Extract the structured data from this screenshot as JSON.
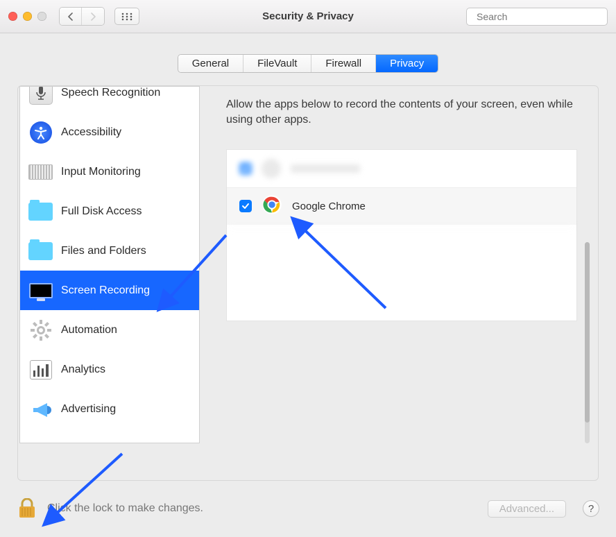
{
  "window_title": "Security & Privacy",
  "search": {
    "placeholder": "Search"
  },
  "tabs": {
    "items": [
      "General",
      "FileVault",
      "Firewall",
      "Privacy"
    ],
    "active_index": 3
  },
  "sidebar": {
    "items": [
      {
        "label": "Speech Recognition",
        "icon": "microphone-icon"
      },
      {
        "label": "Accessibility",
        "icon": "accessibility-icon"
      },
      {
        "label": "Input Monitoring",
        "icon": "keyboard-icon"
      },
      {
        "label": "Full Disk Access",
        "icon": "folder-icon"
      },
      {
        "label": "Files and Folders",
        "icon": "folder-icon"
      },
      {
        "label": "Screen Recording",
        "icon": "monitor-icon"
      },
      {
        "label": "Automation",
        "icon": "gear-icon"
      },
      {
        "label": "Analytics",
        "icon": "bar-chart-icon"
      },
      {
        "label": "Advertising",
        "icon": "megaphone-icon"
      }
    ],
    "selected_index": 5
  },
  "detail": {
    "description": "Allow the apps below to record the contents of your screen, even while using other apps.",
    "apps": [
      {
        "name": "Google Chrome",
        "checked": true
      }
    ]
  },
  "footer": {
    "lock_text": "Click the lock to make changes.",
    "advanced_label": "Advanced...",
    "help_label": "?"
  }
}
